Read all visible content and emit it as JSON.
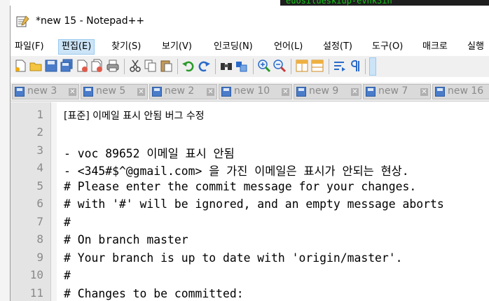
{
  "window": {
    "title": "*new 15 - Notepad++"
  },
  "background": {
    "terminal_text": "euosilueskiup-evnk3in"
  },
  "menu": [
    {
      "label": "파일(F)",
      "active": false
    },
    {
      "label": "편집(E)",
      "active": true
    },
    {
      "label": "찾기(S)",
      "active": false
    },
    {
      "label": "보기(V)",
      "active": false
    },
    {
      "label": "인코딩(N)",
      "active": false
    },
    {
      "label": "언어(L)",
      "active": false
    },
    {
      "label": "설정(T)",
      "active": false
    },
    {
      "label": "도구(O)",
      "active": false
    },
    {
      "label": "매크로",
      "active": false
    },
    {
      "label": "실행",
      "active": false
    }
  ],
  "toolbar": [
    "new-file-icon",
    "open-file-icon",
    "save-icon",
    "save-all-icon",
    "close-icon",
    "close-all-icon",
    "print-icon",
    "cut-icon",
    "copy-icon",
    "paste-icon",
    "undo-icon",
    "redo-icon",
    "find-icon",
    "replace-icon",
    "zoom-in-icon",
    "zoom-out-icon",
    "sync-vertical-icon",
    "sync-horizontal-icon",
    "word-wrap-icon",
    "show-all-chars-icon"
  ],
  "tabs": [
    {
      "label": "new 3"
    },
    {
      "label": "new 5"
    },
    {
      "label": "new 2"
    },
    {
      "label": "new 10"
    },
    {
      "label": "new 9"
    },
    {
      "label": "new 7"
    },
    {
      "label": "new 16"
    }
  ],
  "editor": {
    "lines": [
      {
        "num": "1",
        "text": "[표준] 이메일 표시 안됨 버그 수정"
      },
      {
        "num": "2",
        "text": ""
      },
      {
        "num": "3",
        "text": "- voc 89652 이메일 표시 안됨"
      },
      {
        "num": "4",
        "text": "- <345#$^@gmail.com> 을 가진 이메일은 표시가 안되는 현상."
      },
      {
        "num": "5",
        "text": "# Please enter the commit message for your changes."
      },
      {
        "num": "6",
        "text": "# with '#' will be ignored, and an empty message aborts"
      },
      {
        "num": "7",
        "text": "#"
      },
      {
        "num": "8",
        "text": "# On branch master"
      },
      {
        "num": "9",
        "text": "# Your branch is up to date with 'origin/master'."
      },
      {
        "num": "10",
        "text": "#"
      },
      {
        "num": "11",
        "text": "# Changes to be committed:"
      }
    ]
  },
  "colors": {
    "menu_highlight": "#cce4f7",
    "gutter_bg": "#e4e4e4",
    "line_number": "#8a8a8a",
    "tab_save_icon": "#4a7cc9"
  }
}
